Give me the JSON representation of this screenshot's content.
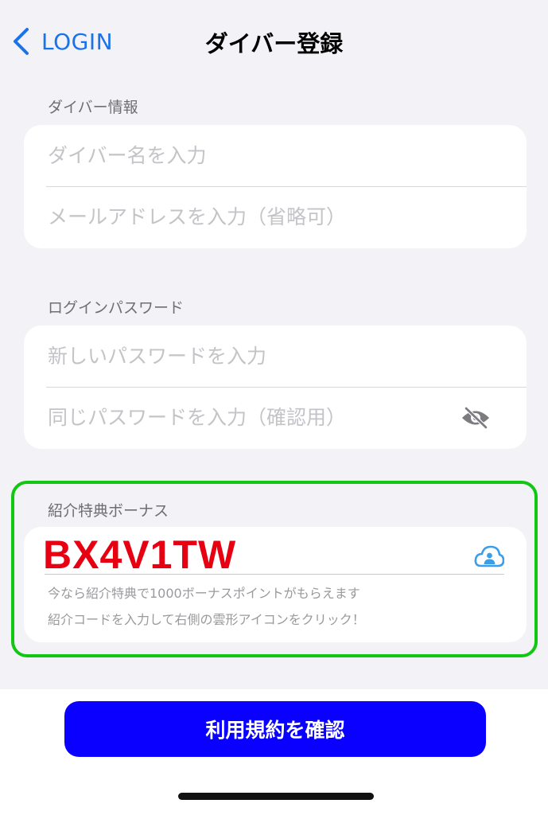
{
  "nav": {
    "back_label": "LOGIN",
    "title": "ダイバー登録"
  },
  "diver_info": {
    "header": "ダイバー情報",
    "name_placeholder": "ダイバー名を入力",
    "email_placeholder": "メールアドレスを入力（省略可）"
  },
  "password": {
    "header": "ログインパスワード",
    "new_placeholder": "新しいパスワードを入力",
    "confirm_placeholder": "同じパスワードを入力（確認用）"
  },
  "referral": {
    "header": "紹介特典ボーナス",
    "code": "BX4V1TW",
    "help_line1": "今なら紹介特典で1000ボーナスポイントがもらえます",
    "help_line2": "紹介コードを入力して右側の雲形アイコンをクリック！"
  },
  "footer": {
    "terms_button": "利用規約を確認"
  },
  "colors": {
    "accent": "#1a73e8",
    "primary_button": "#0a00ff",
    "highlight": "#12c712",
    "code_text": "#e60012",
    "background": "#f2f2f7"
  },
  "icons": {
    "back": "chevron-left-icon",
    "visibility": "eye-slash-icon",
    "apply_code": "cloud-user-icon"
  }
}
